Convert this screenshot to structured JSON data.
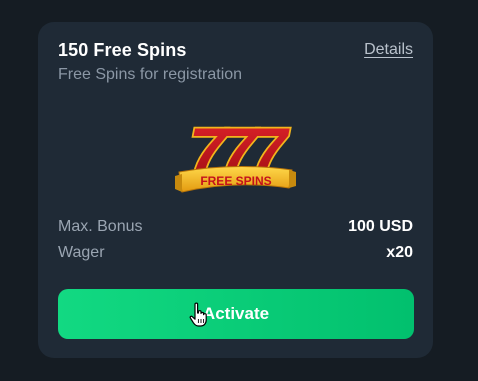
{
  "bonus": {
    "title": "150 Free Spins",
    "details_link": "Details",
    "subtitle": "Free Spins for registration",
    "logo": {
      "digits": "777",
      "ribbon_text": "FREE SPINS"
    },
    "max_bonus_label": "Max. Bonus",
    "max_bonus_value": "100 USD",
    "wager_label": "Wager",
    "wager_value": "x20",
    "activate_label": "Activate"
  },
  "colors": {
    "background": "#151c23",
    "card": "#1f2a36",
    "button": "#0ecf79",
    "logo_red": "#c5121b",
    "logo_gold": "#f2b51c"
  }
}
